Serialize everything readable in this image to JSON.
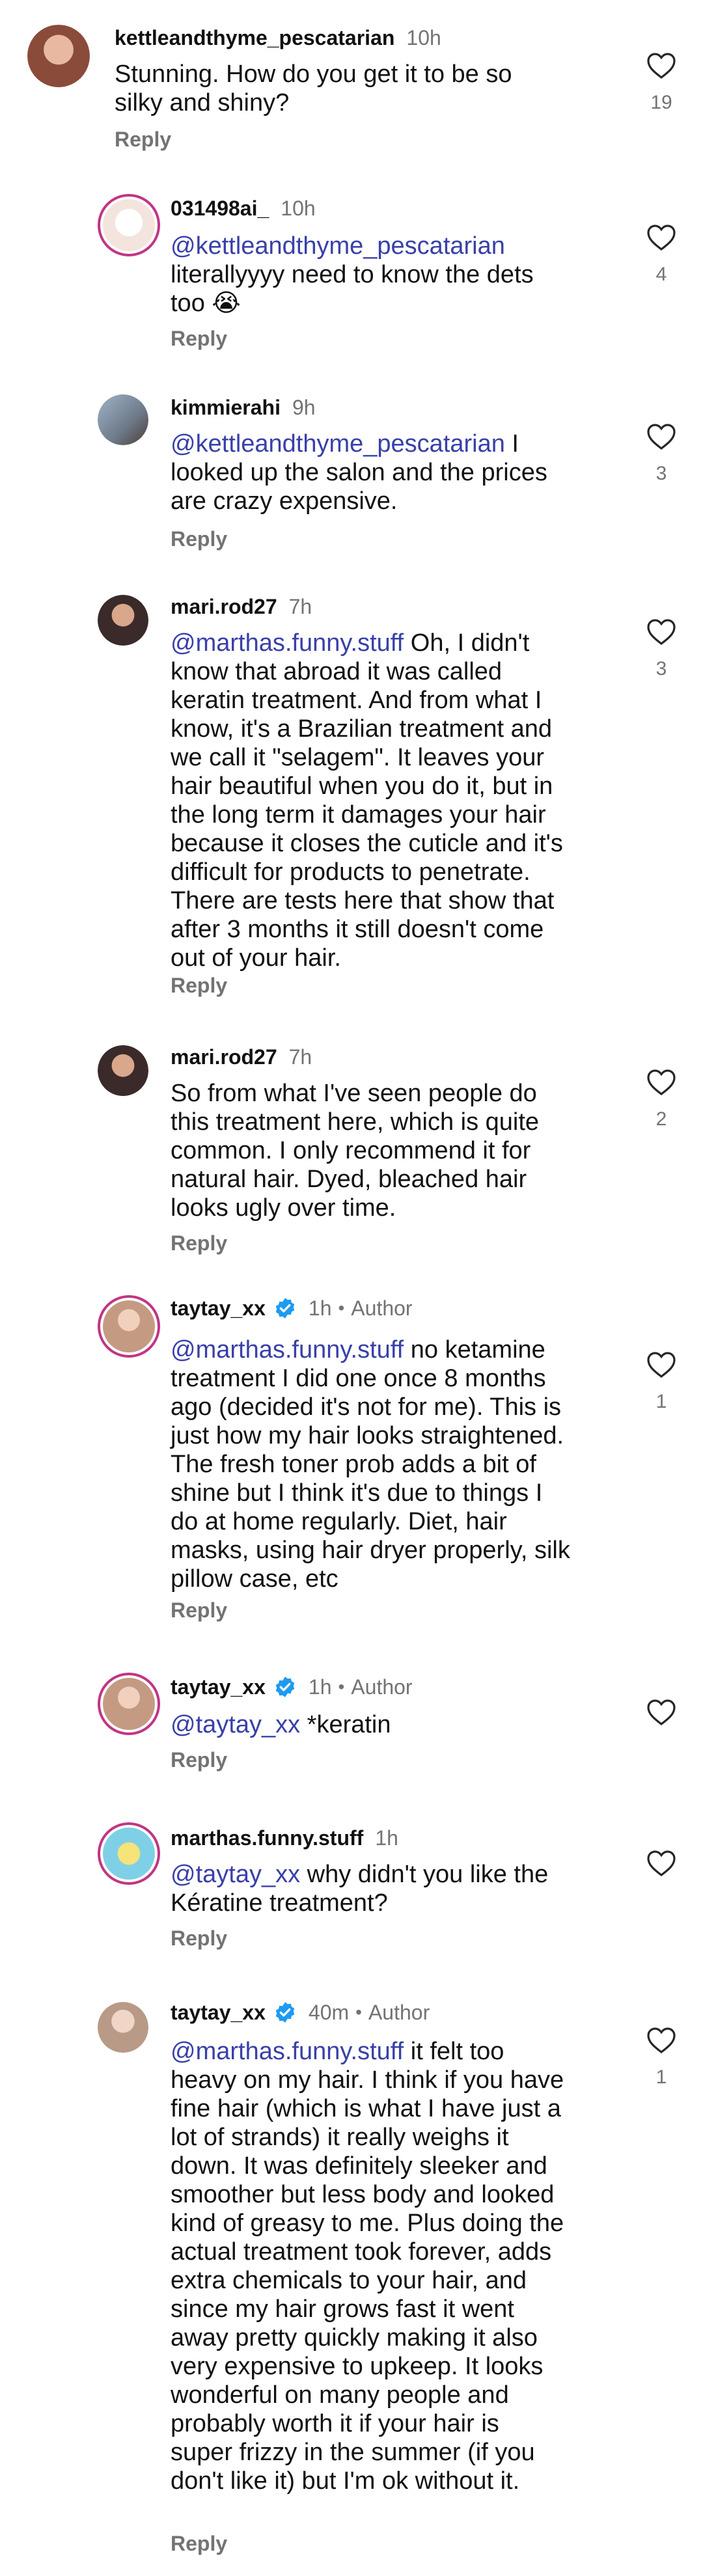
{
  "comments": [
    {
      "username": "kettleandthyme_pescatarian",
      "time": "10h",
      "mention": "",
      "text": "Stunning. How do you get it to be so\nsilky and shiny?",
      "reply_label": "Reply",
      "likes": "19",
      "avatar_color": "#8a4b3a"
    },
    {
      "username": "031498ai_",
      "time": "10h",
      "mention": "@kettleandthyme_pescatarian",
      "text": "literallyyyy need to know the dets\ntoo 😭",
      "reply_label": "Reply",
      "likes": "4",
      "avatar_color": "#f3e4de"
    },
    {
      "username": "kimmierahi",
      "time": "9h",
      "mention": "@kettleandthyme_pescatarian",
      "text": " I\nlooked up the salon and the prices\nare crazy expensive.",
      "reply_label": "Reply",
      "likes": "3",
      "avatar_color": "#6d7a8a"
    },
    {
      "username": "mari.rod27",
      "time": "7h",
      "mention": "@marthas.funny.stuff",
      "text": " Oh, I didn't\nknow that abroad it was called\nkeratin treatment. And from what I\nknow, it's a Brazilian treatment and\nwe call it \"selagem\". It leaves your\nhair beautiful when you do it, but in\nthe long term it damages your hair\nbecause it closes the cuticle and it's\ndifficult for products to penetrate.\nThere are tests here that show that\nafter 3 months it still doesn't come\nout of your hair.",
      "reply_label": "Reply",
      "likes": "3",
      "avatar_color": "#3a2a2a"
    },
    {
      "username": "mari.rod27",
      "time": "7h",
      "mention": "",
      "text": "So from what I've seen people do\nthis treatment here, which is quite\ncommon. I only recommend it for\nnatural hair. Dyed, bleached hair\nlooks ugly over time.",
      "reply_label": "Reply",
      "likes": "2",
      "avatar_color": "#3a2a2a"
    },
    {
      "username": "taytay_xx",
      "time": "1h",
      "author_label": "Author",
      "mention": "@marthas.funny.stuff",
      "text": " no ketamine\ntreatment I did one once 8 months\nago (decided it's not for me). This is\njust how my hair looks straightened.\nThe fresh toner prob adds a bit of\nshine but I think it's due to things I\ndo at home regularly. Diet, hair\nmasks, using hair dryer properly, silk\npillow case, etc",
      "reply_label": "Reply",
      "likes": "1",
      "avatar_color": "#c49b82"
    },
    {
      "username": "taytay_xx",
      "time": "1h",
      "author_label": "Author",
      "mention": "@taytay_xx",
      "text": " *keratin",
      "reply_label": "Reply",
      "likes": "",
      "avatar_color": "#c49b82"
    },
    {
      "username": "marthas.funny.stuff",
      "time": "1h",
      "mention": "@taytay_xx",
      "text": " why didn't you like the\nKératine treatment?",
      "reply_label": "Reply",
      "likes": "",
      "avatar_color": "#7fd0e6"
    },
    {
      "username": "taytay_xx",
      "time": "40m",
      "author_label": "Author",
      "mention": "@marthas.funny.stuff",
      "text": " it felt too\nheavy on my hair. I think if you have\nfine hair (which is what I have just a\nlot of strands) it really weighs it\ndown. It was definitely sleeker and\nsmoother but less body and looked\nkind of greasy to me. Plus doing the\nactual treatment took forever, adds\nextra chemicals to your hair, and\nsince my hair grows fast it went\naway pretty quickly making it also\nvery expensive to upkeep. It looks\nwonderful on many people and\nprobably worth it if your hair is\nsuper frizzy in the summer (if you\ndon't like it) but I'm ok without it.",
      "reply_label": "Reply",
      "likes": "1",
      "avatar_color": "#b89a86"
    }
  ],
  "colors": {
    "mention": "#3940a8",
    "secondary": "#737373",
    "verified": "#1d9bf0"
  }
}
